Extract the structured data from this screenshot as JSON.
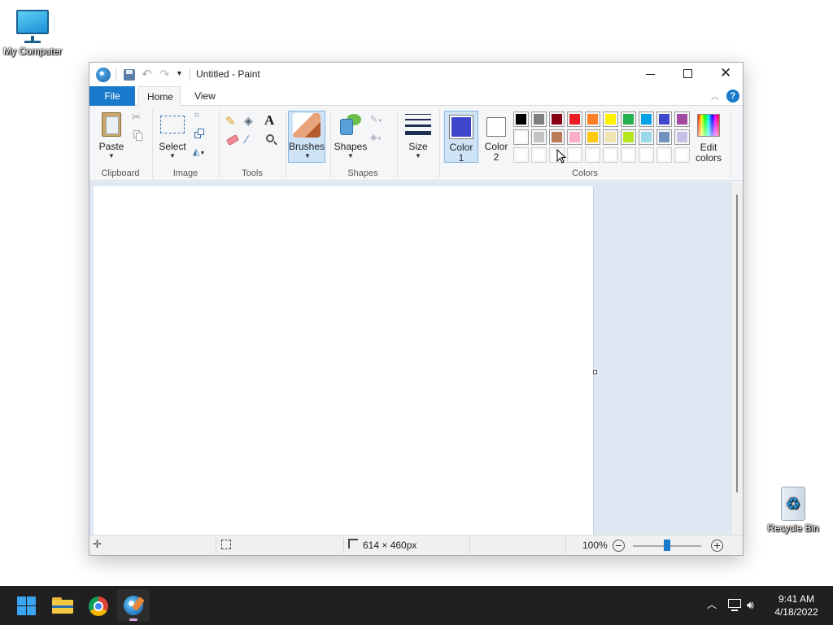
{
  "desktop": {
    "icons": [
      {
        "label": "My Computer"
      },
      {
        "label": "Recycle Bin"
      }
    ]
  },
  "window": {
    "title": "Untitled - Paint",
    "tabs": [
      {
        "label": "File"
      },
      {
        "label": "Home"
      },
      {
        "label": "View"
      }
    ],
    "ribbon": {
      "clipboard": {
        "label": "Clipboard",
        "paste": "Paste"
      },
      "image": {
        "label": "Image",
        "select": "Select"
      },
      "tools": {
        "label": "Tools"
      },
      "brushes": "Brushes",
      "shapes": {
        "label": "Shapes",
        "button": "Shapes"
      },
      "size": "Size",
      "color1": {
        "line1": "Color",
        "line2": "1",
        "value": "#3f48cc"
      },
      "color2": {
        "line1": "Color",
        "line2": "2",
        "value": "#ffffff"
      },
      "colors": {
        "label": "Colors"
      },
      "edit_colors": {
        "line1": "Edit",
        "line2": "colors"
      },
      "palette_row1": [
        "#000000",
        "#7f7f7f",
        "#880015",
        "#ed1c24",
        "#ff7f27",
        "#fff200",
        "#22b14c",
        "#00a2e8",
        "#3f48cc",
        "#a349a4"
      ],
      "palette_row2": [
        "#ffffff",
        "#c3c3c3",
        "#b97a57",
        "#ffaec9",
        "#ffc90e",
        "#efe4b0",
        "#b5e61d",
        "#99d9ea",
        "#7092be",
        "#c8bfe7"
      ],
      "palette_row3": [
        "#ffffff",
        "#ffffff",
        "#ffffff",
        "#ffffff",
        "#ffffff",
        "#ffffff",
        "#ffffff",
        "#ffffff",
        "#ffffff",
        "#ffffff"
      ]
    },
    "status": {
      "dimensions": "614 × 460px",
      "zoom": "100%",
      "zoom_level": 0.5
    }
  },
  "taskbar": {
    "time": "9:41 AM",
    "date": "4/18/2022"
  },
  "colors": {
    "accent": "#0078d7",
    "taskbar": "#202020"
  }
}
